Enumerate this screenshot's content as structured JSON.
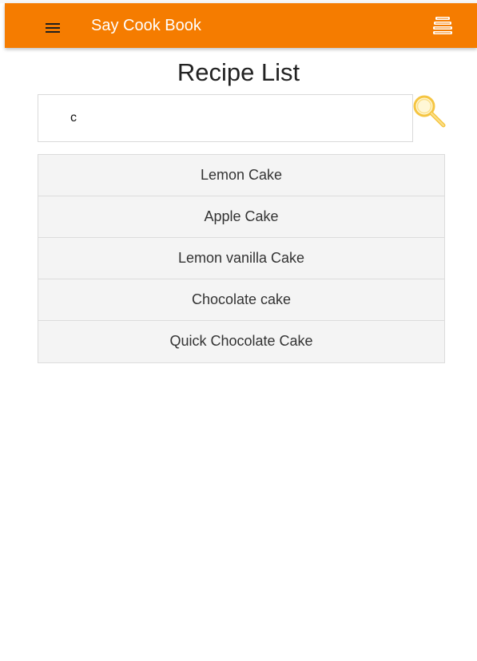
{
  "toolbar": {
    "menu_icon": "menu-icon",
    "title": "Say Cook Book",
    "action_icon": "book-stack-icon",
    "accent_color": "#f57c00"
  },
  "page": {
    "title": "Recipe List"
  },
  "search": {
    "value": "c",
    "icon": "magnifier-icon"
  },
  "recipes": [
    {
      "name": "Lemon Cake"
    },
    {
      "name": "Apple Cake"
    },
    {
      "name": "Lemon vanilla Cake"
    },
    {
      "name": "Chocolate cake"
    },
    {
      "name": "Quick Chocolate Cake"
    }
  ]
}
